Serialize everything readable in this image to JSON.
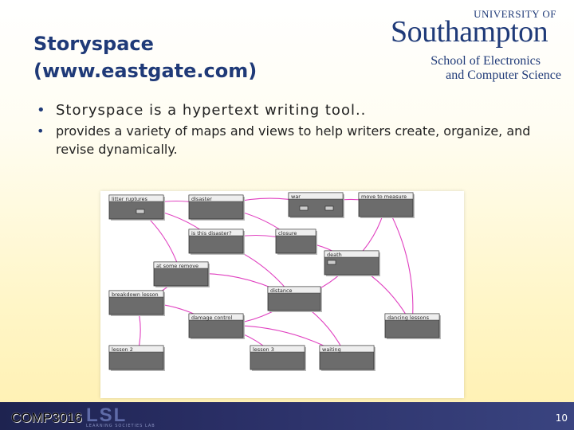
{
  "slide": {
    "title_line1": "Storyspace",
    "title_line2": "(www.eastgate.com)",
    "bullets": [
      "Storyspace is a hypertext writing tool..",
      "provides a variety of maps and views to help writers create, organize, and revise dynamically."
    ]
  },
  "logo": {
    "university_of": "UNIVERSITY OF",
    "southampton": "Southampton",
    "school_line1": "School of Electronics",
    "school_line2": "and Computer Science"
  },
  "storyspace_map": {
    "nodes": [
      {
        "id": "n1",
        "label": "litter ruptures"
      },
      {
        "id": "n2",
        "label": "disaster"
      },
      {
        "id": "n3",
        "label": "war"
      },
      {
        "id": "n4",
        "label": "move to measure"
      },
      {
        "id": "n5",
        "label": "is this disaster?"
      },
      {
        "id": "n6",
        "label": "closure"
      },
      {
        "id": "n7",
        "label": "death"
      },
      {
        "id": "n8",
        "label": "at some remove"
      },
      {
        "id": "n9",
        "label": "breakdown lesson"
      },
      {
        "id": "n10",
        "label": "distance"
      },
      {
        "id": "n11",
        "label": "damage control"
      },
      {
        "id": "n12",
        "label": "dancing lessons"
      },
      {
        "id": "n13",
        "label": "lesson 2"
      },
      {
        "id": "n14",
        "label": "lesson 3"
      },
      {
        "id": "n15",
        "label": "waiting"
      }
    ]
  },
  "footer": {
    "course": "COMP3016",
    "lab_logo": "LSL",
    "lab_sub": "LEARNING SOCIETIES LAB",
    "page_number": "10"
  },
  "colors": {
    "title": "#1f3a78",
    "node_fill": "#6c6c6c",
    "link": "#e040c0"
  }
}
